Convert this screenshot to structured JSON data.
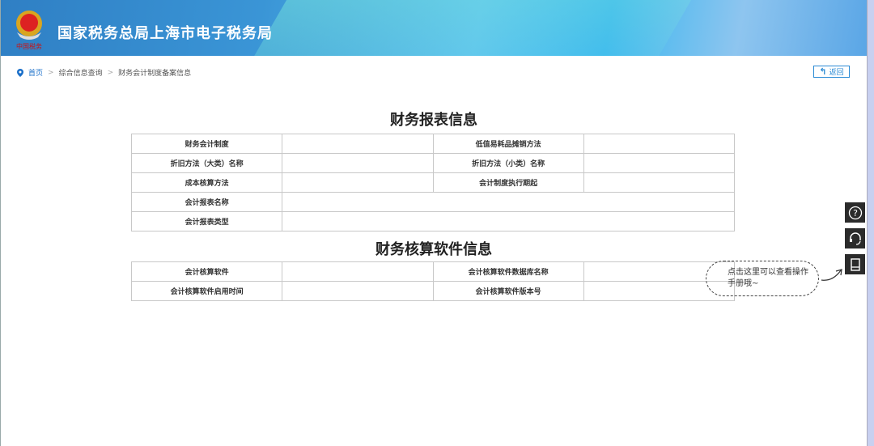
{
  "header": {
    "title": "国家税务总局上海市电子税务局",
    "emblem_text": "中国税务"
  },
  "breadcrumb": [
    "首页",
    "综合信息查询",
    "财务会计制度备案信息"
  ],
  "back_label": "返回",
  "section1": {
    "title": "财务报表信息",
    "rows": [
      [
        "财务会计制度",
        "",
        "低值易耗品摊销方法",
        ""
      ],
      [
        "折旧方法（大类）名称",
        "",
        "折旧方法（小类）名称",
        ""
      ],
      [
        "成本核算方法",
        "",
        "会计制度执行期起",
        ""
      ],
      [
        "会计报表名称",
        ""
      ],
      [
        "会计报表类型",
        ""
      ]
    ]
  },
  "section2": {
    "title": "财务核算软件信息",
    "rows": [
      [
        "会计核算软件",
        "",
        "会计核算软件数据库名称",
        ""
      ],
      [
        "会计核算软件启用时间",
        "",
        "会计核算软件版本号",
        ""
      ]
    ]
  },
  "side_tools": {
    "help": "?",
    "tip": "点击这里可以查看操作手册哦~"
  }
}
